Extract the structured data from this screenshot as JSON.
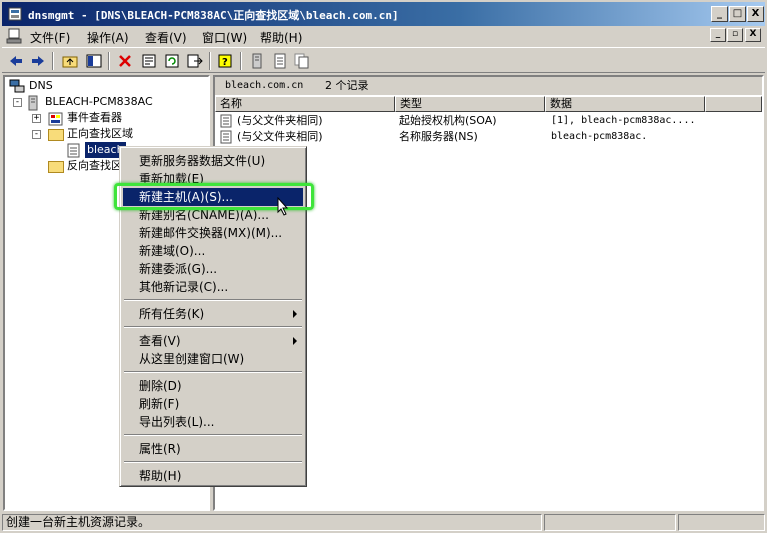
{
  "window": {
    "title": "dnsmgmt - [DNS\\BLEACH-PCM838AC\\正向查找区域\\bleach.com.cn]",
    "minimize_label": "_",
    "maximize_label": "□",
    "close_label": "X"
  },
  "menubar": {
    "items": [
      "文件(F)",
      "操作(A)",
      "查看(V)",
      "窗口(W)",
      "帮助(H)"
    ],
    "mdi_minimize": "_",
    "mdi_restore": "▫",
    "mdi_close": "X"
  },
  "toolbar": {
    "buttons": [
      "back-icon",
      "forward-icon",
      "up-folder-icon",
      "show-hide-tree-icon",
      "delete-icon",
      "properties-icon",
      "refresh-icon",
      "export-icon",
      "help-icon",
      "server-icon",
      "document-icon",
      "copy-icon"
    ]
  },
  "tree": {
    "root": "DNS",
    "server": "BLEACH-PCM838AC",
    "event_viewer": "事件查看器",
    "forward_zones": "正向查找区域",
    "selected_zone": "bleach",
    "reverse_zones": "反向查找区"
  },
  "list": {
    "caption_zone": "bleach.com.cn",
    "caption_count": "2 个记录",
    "columns": [
      "名称",
      "类型",
      "数据"
    ],
    "rows": [
      {
        "name": "(与父文件夹相同)",
        "type": "起始授权机构(SOA)",
        "data": "[1], bleach-pcm838ac...."
      },
      {
        "name": "(与父文件夹相同)",
        "type": "名称服务器(NS)",
        "data": "bleach-pcm838ac."
      }
    ]
  },
  "context_menu": {
    "items": [
      "更新服务器数据文件(U)",
      "重新加载(E)",
      "新建主机(A)(S)...",
      "新建别名(CNAME)(A)...",
      "新建邮件交换器(MX)(M)...",
      "新建域(O)...",
      "新建委派(G)...",
      "其他新记录(C)...",
      "所有任务(K)",
      "查看(V)",
      "从这里创建窗口(W)",
      "删除(D)",
      "刷新(F)",
      "导出列表(L)...",
      "属性(R)",
      "帮助(H)"
    ],
    "selected_index": 2
  },
  "statusbar": {
    "text": "创建一台新主机资源记录。"
  },
  "colors": {
    "title_gradient_start": "#0a246a",
    "selection": "#0a246a",
    "highlight_ring": "#3ee43a",
    "window_face": "#d4d0c8"
  }
}
